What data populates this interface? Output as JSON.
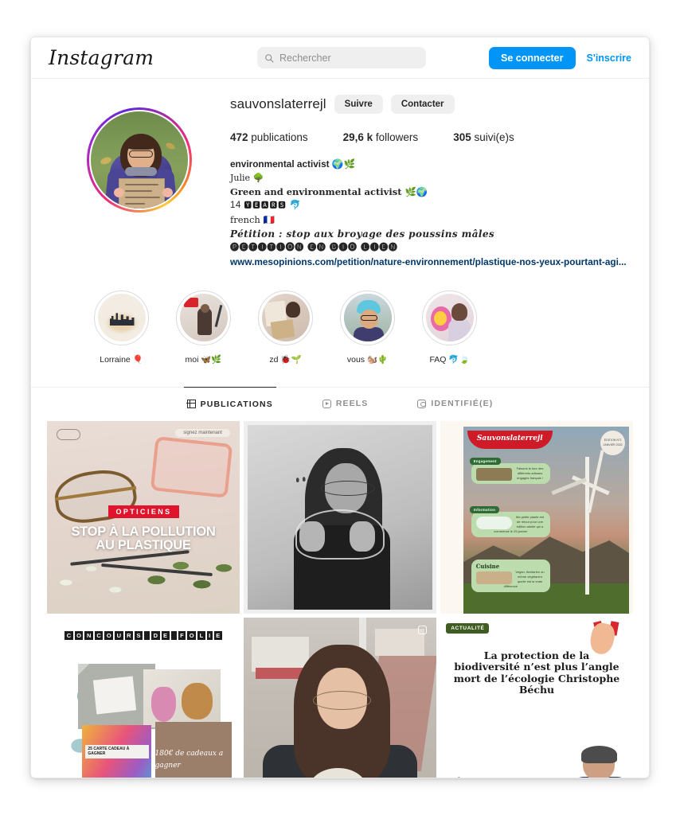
{
  "nav": {
    "brand": "Instagram",
    "search_placeholder": "Rechercher",
    "search_value": "",
    "search_icon": "search-icon",
    "login_label": "Se connecter",
    "signup_label": "S'inscrire",
    "accent_color": "#0095f6"
  },
  "profile": {
    "username": "sauvonslaterrejl",
    "follow_label": "Suivre",
    "contact_label": "Contacter",
    "stats": [
      {
        "value": "472",
        "label": "publications"
      },
      {
        "value": "29,6 k",
        "label": "followers"
      },
      {
        "value": "305",
        "label": "suivi(e)s"
      }
    ],
    "bio": {
      "line1": "environmental activist 🌍🌿",
      "line2": "Julie 🌳",
      "line3": "Green and environmental activist 🌿🌍",
      "line4_prefix": "14 ",
      "line4_boxed": "🆈🅴🅰🆁🆂",
      "line4_suffix": " 🐬",
      "line5": "french 🇫🇷",
      "line6": "Pétition : stop aux broyage des poussins mâles",
      "line7_circled": "🅟🅔🅣🅘🅣🅘🅞🅝 🅔🅝 🅑🅘🅞 🅛🅘🅔🅝",
      "link": "www.mesopinions.com/petition/nature-environnement/plastique-nos-yeux-pourtant-agi...",
      "link_color": "#00376b"
    }
  },
  "highlights": [
    {
      "label": "Lorraine 🎈",
      "name": "lorraine"
    },
    {
      "label": "moi 🦋🌿",
      "name": "moi"
    },
    {
      "label": "zd 🐞🌱",
      "name": "zd"
    },
    {
      "label": "vous 🐿️🌵",
      "name": "vous"
    },
    {
      "label": "FAQ 🐬🍃",
      "name": "faq"
    }
  ],
  "tabs": [
    {
      "label": "PUBLICATIONS",
      "icon": "grid-icon",
      "active": true
    },
    {
      "label": "REELS",
      "icon": "reels-icon",
      "active": false
    },
    {
      "label": "IDENTIFIÉ(E)",
      "icon": "tagged-icon",
      "active": false
    }
  ],
  "posts": [
    {
      "name": "post-opticiens",
      "badge": "signez maintenant",
      "eyebrow": "OPTICIENS",
      "title_line1": "STOP À LA POLLUTION",
      "title_line2": "AU PLASTIQUE"
    },
    {
      "name": "post-bw-portrait",
      "caption": ""
    },
    {
      "name": "post-newsletter",
      "title": "Sauvonslaterrejl",
      "stamp": "EDITION N°2 JANVIER 2022",
      "sections": [
        {
          "tag": "Engagement",
          "text": "Faisons le tour des différents artisans engagés français !"
        },
        {
          "tag": "Information",
          "text": "Ma petite plante est de retour pour une édition adulte qui a commencé le 25 janvier"
        },
        {
          "tag": "Cuisine",
          "text": "Vegan, flexitarien ou même végétarien quelle est la vraie différence"
        }
      ]
    },
    {
      "name": "post-concours",
      "header": "CONCOURS DE FOLIE",
      "card_label": "25 CARTE CADEAU À GAGNER",
      "amount": "180€ de cadeaux a gagner"
    },
    {
      "name": "post-selfie-reel",
      "icon": "reels-icon"
    },
    {
      "name": "post-actualite",
      "badge": "ACTUALITÉ",
      "headline": "La protection de la biodiversité n’est plus l’angle mort de l’écologie Christophe Béchu"
    }
  ]
}
